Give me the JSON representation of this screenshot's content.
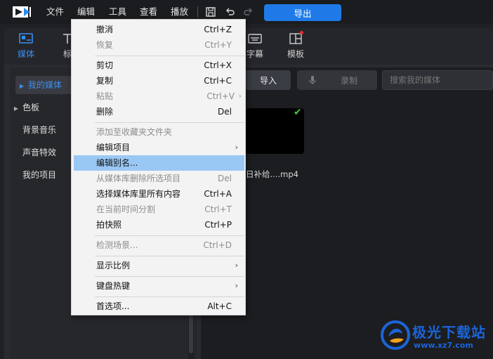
{
  "menubar": {
    "items": [
      "文件",
      "编辑",
      "工具",
      "查看",
      "播放"
    ],
    "export_label": "导出",
    "icons": [
      "app-logo-icon",
      "save-icon",
      "undo-icon",
      "redo-icon"
    ],
    "accent": "#1f7ae8"
  },
  "tabs": [
    {
      "label": "媒体",
      "icon": "media-icon",
      "active": true
    },
    {
      "label": "标",
      "icon": "title-icon"
    },
    {
      "label": "字幕",
      "icon": "subtitle-icon"
    },
    {
      "label": "模板",
      "icon": "template-icon",
      "badge": "red-dot"
    }
  ],
  "sidebar": {
    "items": [
      {
        "label": "我的媒体",
        "expandable": true,
        "active": true
      },
      {
        "label": "色板",
        "expandable": true
      },
      {
        "label": "背景音乐"
      },
      {
        "label": "声音特效"
      },
      {
        "label": "我的项目"
      }
    ]
  },
  "toolbar": {
    "import_label": "导入",
    "record_label": "录制",
    "search_placeholder": "搜索我的媒体"
  },
  "media": {
    "file_name": "日补给....mp4"
  },
  "context_menu": {
    "items": [
      {
        "label": "撤消",
        "shortcut": "Ctrl+Z",
        "enabled": true
      },
      {
        "label": "恢复",
        "shortcut": "Ctrl+Y",
        "enabled": false
      },
      {
        "label": "剪切",
        "shortcut": "Ctrl+X",
        "enabled": true
      },
      {
        "label": "复制",
        "shortcut": "Ctrl+C",
        "enabled": true
      },
      {
        "label": "粘贴",
        "shortcut": "Ctrl+V",
        "enabled": false,
        "submenu": true
      },
      {
        "label": "删除",
        "shortcut": "Del",
        "enabled": true
      },
      {
        "label": "添加至收藏夹文件夹",
        "shortcut": "",
        "enabled": false
      },
      {
        "label": "编辑项目",
        "shortcut": "",
        "enabled": true,
        "submenu": true
      },
      {
        "label": "编辑别名...",
        "shortcut": "",
        "enabled": true,
        "highlighted": true
      },
      {
        "label": "从媒体库删除所选项目",
        "shortcut": "Del",
        "enabled": false
      },
      {
        "label": "选择媒体库里所有内容",
        "shortcut": "Ctrl+A",
        "enabled": true
      },
      {
        "label": "在当前时间分割",
        "shortcut": "Ctrl+T",
        "enabled": false
      },
      {
        "label": "拍快照",
        "shortcut": "Ctrl+P",
        "enabled": true
      },
      {
        "label": "检测场景...",
        "shortcut": "Ctrl+D",
        "enabled": false
      },
      {
        "label": "显示比例",
        "shortcut": "",
        "enabled": true,
        "submenu": true
      },
      {
        "label": "键盘热键",
        "shortcut": "",
        "enabled": true,
        "submenu": true
      },
      {
        "label": "首选项...",
        "shortcut": "Alt+C",
        "enabled": true
      }
    ],
    "highlight_color": "#9ac8f5"
  },
  "watermark": {
    "name": "极光下载站",
    "url": "www.xz7.com"
  }
}
